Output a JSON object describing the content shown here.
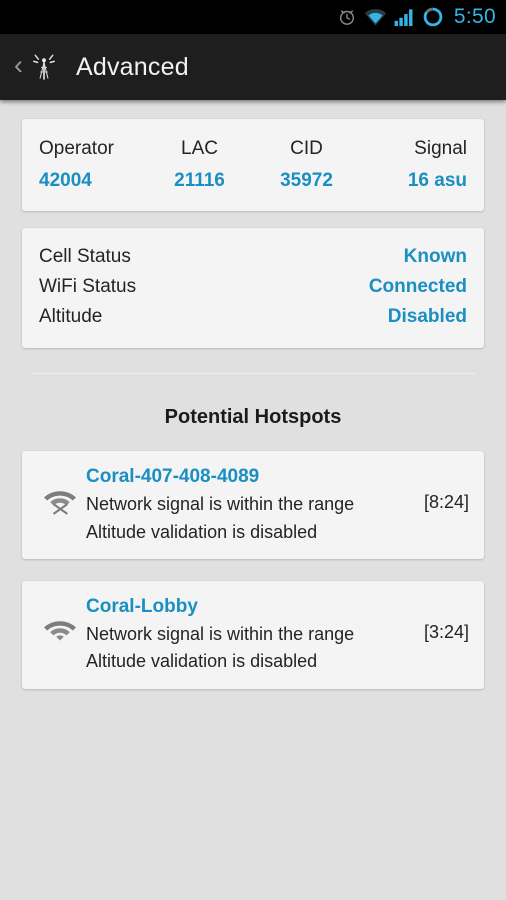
{
  "status_bar": {
    "icons": [
      "alarm-clock-icon",
      "wifi-icon",
      "cellular-signal-icon",
      "sync-circle-icon"
    ],
    "time": "5:50",
    "accent_color": "#33b5e5",
    "background_color": "#000000"
  },
  "app_bar": {
    "back_label": "‹",
    "app_icon": "antenna-tower-icon",
    "title": "Advanced",
    "background_color": "#1e1e1e"
  },
  "theme": {
    "page_background": "#e0e0e0",
    "card_background": "#f4f4f4",
    "accent_blue": "#1a8fc1",
    "text_primary": "#242424"
  },
  "info_card": {
    "columns": [
      {
        "label": "Operator",
        "value": "42004"
      },
      {
        "label": "LAC",
        "value": "21116"
      },
      {
        "label": "CID",
        "value": "35972"
      },
      {
        "label": "Signal",
        "value": "16 asu"
      }
    ]
  },
  "status_card": {
    "rows": [
      {
        "key": "Cell Status",
        "value": "Known"
      },
      {
        "key": "WiFi Status",
        "value": "Connected"
      },
      {
        "key": "Altitude",
        "value": "Disabled"
      }
    ]
  },
  "hotspots_section": {
    "title": "Potential Hotspots",
    "items": [
      {
        "icon": "wifi-off-icon",
        "name": "Coral-407-408-4089",
        "line1": "Network signal is within the range",
        "line2": "Altitude validation is disabled",
        "time": "[8:24]"
      },
      {
        "icon": "wifi-icon",
        "name": "Coral-Lobby",
        "line1": "Network signal is within the range",
        "line2": "Altitude validation is disabled",
        "time": "[3:24]"
      }
    ]
  }
}
